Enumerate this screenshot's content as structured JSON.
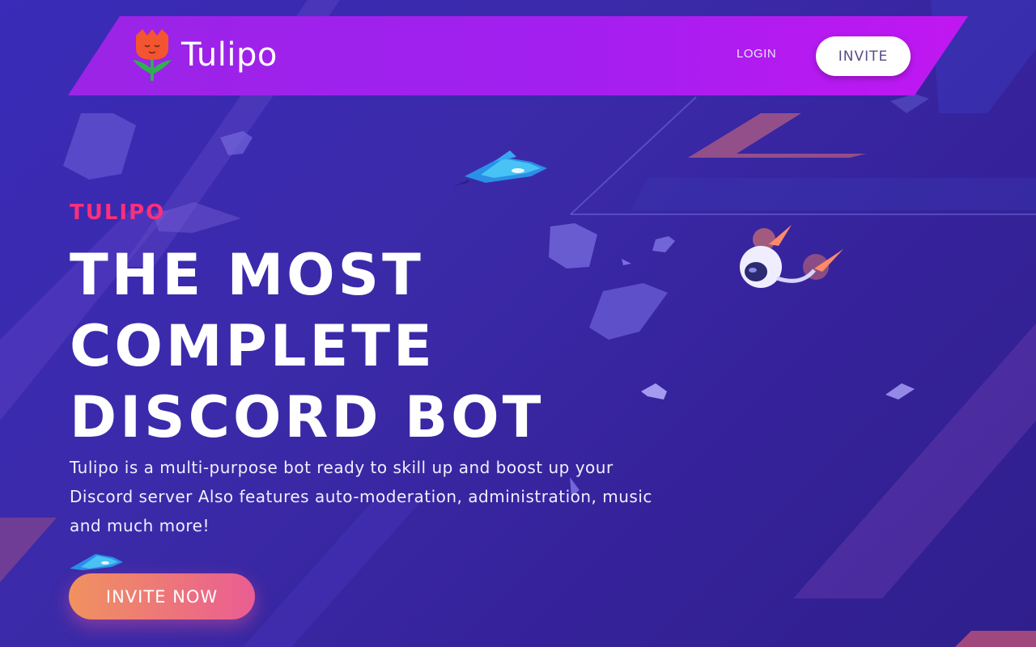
{
  "brand": {
    "name": "Tulipo",
    "logo_icon": "tulip-icon"
  },
  "nav": {
    "login_label": "LOGIN",
    "invite_label": "INVITE"
  },
  "hero": {
    "eyebrow": "TULIPO",
    "headline_lines": [
      "THE MOST",
      "COMPLETE",
      "DISCORD BOT"
    ],
    "description": "Tulipo is a multi-purpose bot ready to skill up and boost up your Discord server Also features auto-moderation, administration, music and much more!",
    "cta_label": "INVITE NOW"
  },
  "colors": {
    "accent_pink": "#ff2f79",
    "header_purple": "#a21ff0",
    "cta_start": "#f0925f",
    "cta_end": "#ea5d92"
  }
}
